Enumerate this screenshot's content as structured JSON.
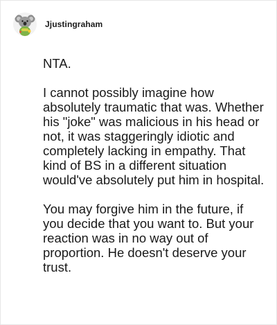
{
  "comment": {
    "username": "Jjustingraham",
    "avatar_icon": "koala-avatar-icon",
    "paragraphs": [
      "NTA.",
      "I cannot possibly imagine how absolutely traumatic that was. Whether his \"joke\" was malicious in his head or not, it was staggeringly idiotic and completely lacking in empathy. That kind of BS in a different situation would've absolutely put him in hospital.",
      "You may forgive him in the future, if you decide that you want to. But your reaction was in no way out of proportion. He doesn't deserve your trust."
    ]
  }
}
